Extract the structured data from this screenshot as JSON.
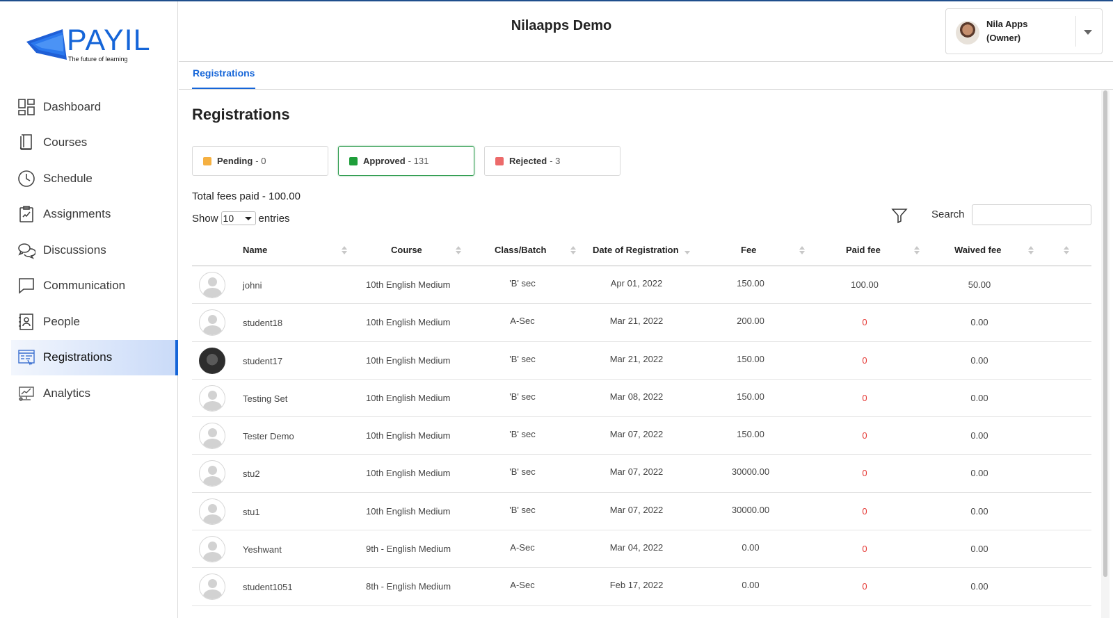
{
  "brand": {
    "name": "PAYIL",
    "tagline": "The future of learning",
    "accent": "#1565d8"
  },
  "sidebar": {
    "items": [
      {
        "label": "Dashboard",
        "icon": "dashboard-icon",
        "active": false
      },
      {
        "label": "Courses",
        "icon": "book-icon",
        "active": false
      },
      {
        "label": "Schedule",
        "icon": "clock-icon",
        "active": false
      },
      {
        "label": "Assignments",
        "icon": "clipboard-icon",
        "active": false
      },
      {
        "label": "Discussions",
        "icon": "chat-bubbles-icon",
        "active": false
      },
      {
        "label": "Communication",
        "icon": "message-icon",
        "active": false
      },
      {
        "label": "People",
        "icon": "id-card-icon",
        "active": false
      },
      {
        "label": "Registrations",
        "icon": "registration-form-icon",
        "active": true
      },
      {
        "label": "Analytics",
        "icon": "analytics-icon",
        "active": false
      }
    ]
  },
  "header": {
    "title": "Nilaapps Demo",
    "user": {
      "name": "Nila Apps",
      "role": "(Owner)"
    }
  },
  "tabs": [
    {
      "label": "Registrations",
      "active": true
    }
  ],
  "main": {
    "title": "Registrations",
    "status_cards": [
      {
        "label": "Pending",
        "count": "- 0",
        "color": "#f5b041"
      },
      {
        "label": "Approved",
        "count": "- 131",
        "color": "#1e9e3a",
        "selected": true
      },
      {
        "label": "Rejected",
        "count": "- 3",
        "color": "#ec6a6a"
      }
    ],
    "total_fees": "Total fees paid - 100.00",
    "show_label": "Show",
    "entries_value": "10",
    "entries_label": "entries",
    "search_label": "Search",
    "search_value": ""
  },
  "table": {
    "columns": [
      "Name",
      "Course",
      "Class/Batch",
      "Date of Registration",
      "Fee",
      "Paid fee",
      "Waived fee"
    ],
    "rows": [
      {
        "name": "johni",
        "course": "10th English Medium",
        "class": "'B' sec",
        "date": "Apr 01, 2022",
        "fee": "150.00",
        "paid": "100.00",
        "waived": "50.00",
        "photo": false
      },
      {
        "name": "student18",
        "course": "10th English Medium",
        "class": "A-Sec",
        "date": "Mar 21, 2022",
        "fee": "200.00",
        "paid": "0",
        "waived": "0.00",
        "photo": false
      },
      {
        "name": "student17",
        "course": "10th English Medium",
        "class": "'B' sec",
        "date": "Mar 21, 2022",
        "fee": "150.00",
        "paid": "0",
        "waived": "0.00",
        "photo": true
      },
      {
        "name": "Testing Set",
        "course": "10th English Medium",
        "class": "'B' sec",
        "date": "Mar 08, 2022",
        "fee": "150.00",
        "paid": "0",
        "waived": "0.00",
        "photo": false
      },
      {
        "name": "Tester Demo",
        "course": "10th English Medium",
        "class": "'B' sec",
        "date": "Mar 07, 2022",
        "fee": "150.00",
        "paid": "0",
        "waived": "0.00",
        "photo": false
      },
      {
        "name": "stu2",
        "course": "10th English Medium",
        "class": "'B' sec",
        "date": "Mar 07, 2022",
        "fee": "30000.00",
        "paid": "0",
        "waived": "0.00",
        "photo": false
      },
      {
        "name": "stu1",
        "course": "10th English Medium",
        "class": "'B' sec",
        "date": "Mar 07, 2022",
        "fee": "30000.00",
        "paid": "0",
        "waived": "0.00",
        "photo": false
      },
      {
        "name": "Yeshwant",
        "course": "9th - English Medium",
        "class": "A-Sec",
        "date": "Mar 04, 2022",
        "fee": "0.00",
        "paid": "0",
        "waived": "0.00",
        "photo": false
      },
      {
        "name": "student1051",
        "course": "8th - English Medium",
        "class": "A-Sec",
        "date": "Feb 17, 2022",
        "fee": "0.00",
        "paid": "0",
        "waived": "0.00",
        "photo": false
      }
    ]
  }
}
